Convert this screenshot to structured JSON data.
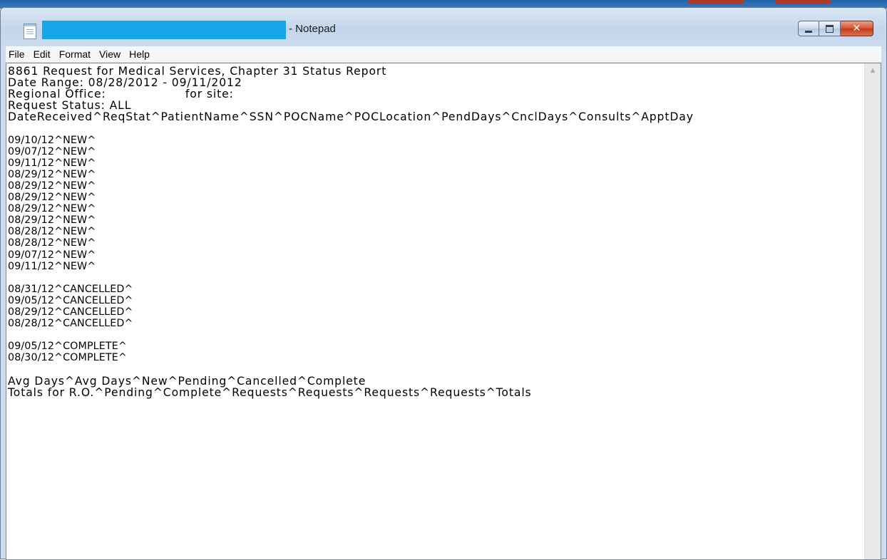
{
  "window": {
    "title_suffix": "- Notepad",
    "title_redacted": ""
  },
  "menu": [
    "File",
    "Edit",
    "Format",
    "View",
    "Help"
  ],
  "document": {
    "lines": [
      "8861 Request for Medical Services, Chapter 31 Status Report",
      "Date Range: 08/28/2012 - 09/11/2012",
      "Regional Office:                   for site:",
      "Request Status: ALL",
      "DateReceived^ReqStat^PatientName^SSN^POCName^POCLocation^PendDays^CnclDays^Consults^ApptDay",
      "",
      "09/10/12^NEW^",
      "09/07/12^NEW^",
      "09/11/12^NEW^",
      "08/29/12^NEW^",
      "08/29/12^NEW^",
      "08/29/12^NEW^",
      "08/29/12^NEW^",
      "08/29/12^NEW^",
      "08/28/12^NEW^",
      "08/28/12^NEW^",
      "09/07/12^NEW^",
      "09/11/12^NEW^",
      "",
      "08/31/12^CANCELLED^",
      "09/05/12^CANCELLED^",
      "08/29/12^CANCELLED^",
      "08/28/12^CANCELLED^",
      "",
      "09/05/12^COMPLETE^",
      "08/30/12^COMPLETE^",
      "",
      "Avg Days^Avg Days^New^Pending^Cancelled^Complete",
      "Totals for R.O.^Pending^Complete^Requests^Requests^Requests^Requests^Totals"
    ]
  },
  "icons": {
    "app": "notepad-icon",
    "minimize": "minimize-icon",
    "maximize": "maximize-icon",
    "close": "close-icon",
    "scroll_up": "scroll-up-arrow-icon"
  },
  "colors": {
    "redaction": "#17a6e8",
    "close_button": "#c23b17"
  }
}
